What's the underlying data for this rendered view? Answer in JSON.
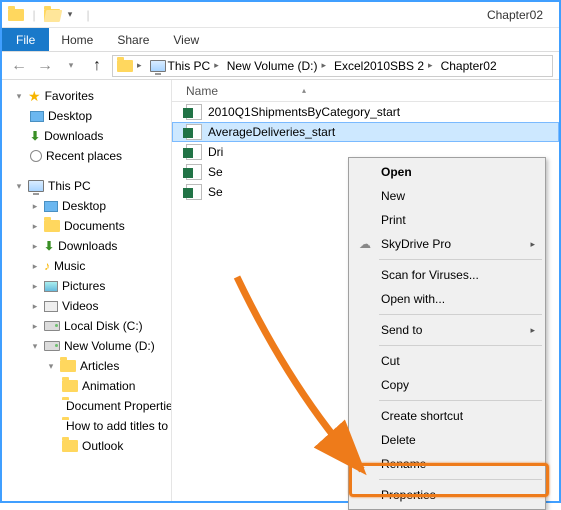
{
  "window": {
    "title": "Chapter02"
  },
  "menubar": {
    "file": "File",
    "home": "Home",
    "share": "Share",
    "view": "View"
  },
  "breadcrumb": {
    "items": [
      "This PC",
      "New Volume (D:)",
      "Excel2010SBS 2",
      "Chapter02"
    ]
  },
  "nav": {
    "favorites": "Favorites",
    "fav_items": [
      "Desktop",
      "Downloads",
      "Recent places"
    ],
    "this_pc": "This PC",
    "pc_items": [
      "Desktop",
      "Documents",
      "Downloads",
      "Music",
      "Pictures",
      "Videos",
      "Local Disk (C:)",
      "New Volume (D:)"
    ],
    "articles": "Articles",
    "article_items": [
      "Animation",
      "Document Properties in Excel",
      "How to add titles to Excel charts",
      "Outlook"
    ]
  },
  "list": {
    "header_name": "Name",
    "files": [
      "2010Q1ShipmentsByCategory_start",
      "AverageDeliveries_start",
      "Dri",
      "Se",
      "Se"
    ],
    "selected_index": 1
  },
  "context_menu": {
    "open": "Open",
    "new": "New",
    "print": "Print",
    "skydrive": "SkyDrive Pro",
    "scan": "Scan for Viruses...",
    "openwith": "Open with...",
    "sendto": "Send to",
    "cut": "Cut",
    "copy": "Copy",
    "shortcut": "Create shortcut",
    "delete": "Delete",
    "rename": "Rename",
    "properties": "Properties"
  }
}
